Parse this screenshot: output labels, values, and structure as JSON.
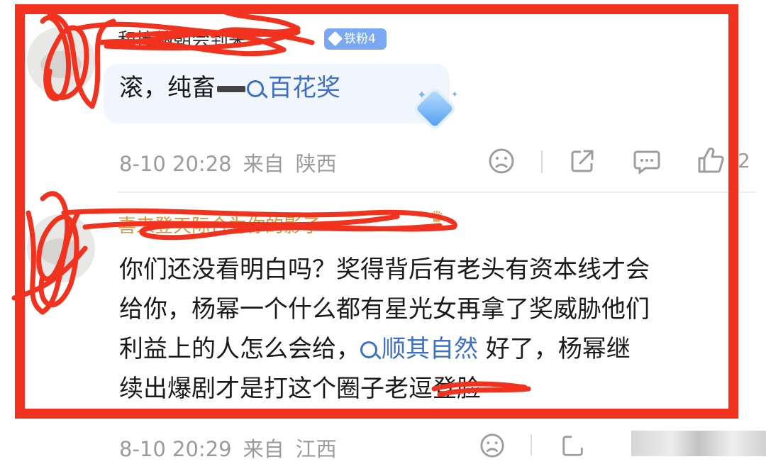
{
  "comments": [
    {
      "username": "和接纳朝会到来",
      "badge": "铁粉4",
      "text_before": "滚，纯畜",
      "topic": "百花奖",
      "time": "8-10 20:28",
      "location_prefix": "来自",
      "location": "陕西",
      "like_count": "2"
    },
    {
      "username": "喜来登天际合为你的影子",
      "lines": [
        "你们还没看明白吗？奖得背后有老头有资本线才会",
        "给你，杨幂一个什么都有星光女再拿了奖威胁他们"
      ],
      "line3_before": "利益上的人怎么会给，",
      "line3_topic": "顺其自然",
      "line3_after": " 好了，杨幂继",
      "line4": "续出爆剧才是打这个圈子老逗登脸",
      "time": "8-10 20:29",
      "location_prefix": "来自",
      "location": "江西"
    }
  ],
  "icons": [
    "sad-face-icon",
    "share-icon",
    "comment-icon",
    "thumbs-up-icon",
    "search-icon",
    "gem-icon"
  ],
  "colors": {
    "frame": "#f0321e",
    "scribble": "#f0321e",
    "topic_link": "#3d6fc4",
    "badge_bg": "#7ba8f2",
    "meta_text": "#9b9b9b"
  }
}
